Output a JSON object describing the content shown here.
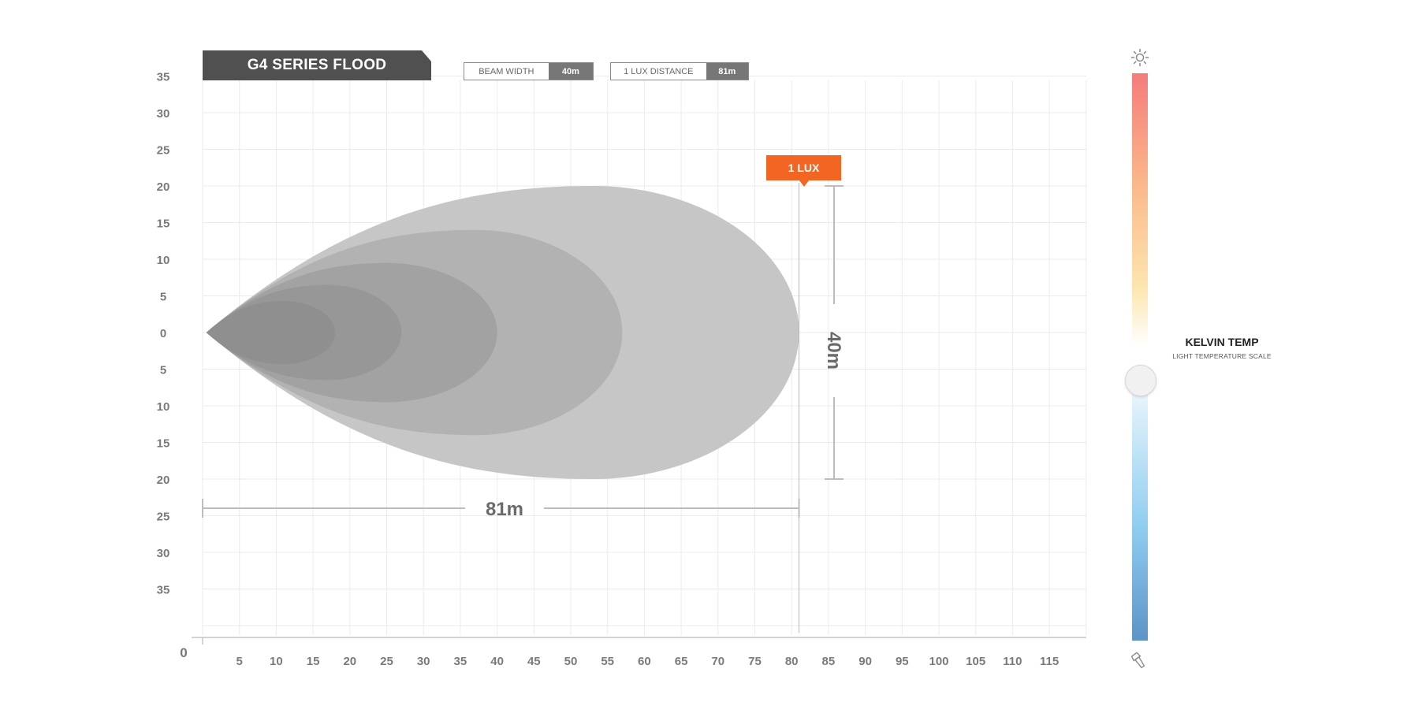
{
  "title": "G4 SERIES FLOOD",
  "stats": {
    "beam_width_label": "BEAM WIDTH",
    "beam_width_value": "40m",
    "lux_distance_label": "1 LUX DISTANCE",
    "lux_distance_value": "81m"
  },
  "lux_tag": "1 LUX",
  "kelvin": {
    "title": "KELVIN TEMP",
    "subtitle": "LIGHT TEMPERATURE SCALE",
    "position": 0.5
  },
  "colors": {
    "lux": "#f26522",
    "title_bg": "#505050",
    "grid": "#ebebeb"
  },
  "icons": {
    "top": "sun-icon",
    "bottom": "flashlight-icon"
  },
  "chart_data": {
    "type": "area",
    "x_ticks": [
      "5",
      "10",
      "15",
      "20",
      "25",
      "30",
      "35",
      "40",
      "45",
      "50",
      "55",
      "60",
      "65",
      "70",
      "75",
      "80",
      "85",
      "90",
      "95",
      "100",
      "105",
      "110",
      "115"
    ],
    "y_ticks": [
      "35",
      "30",
      "25",
      "20",
      "15",
      "10",
      "5",
      "0",
      "5",
      "10",
      "15",
      "20",
      "25",
      "30",
      "35"
    ],
    "origin_label": "0",
    "xlim": [
      0,
      120
    ],
    "ylim": [
      -40,
      35
    ],
    "grid": true,
    "series": [
      {
        "reach": 81,
        "half_width": 20,
        "peak_x": 53,
        "color": "#c6c6c6"
      },
      {
        "reach": 57,
        "half_width": 14,
        "peak_x": 37,
        "color": "#b2b2b2"
      },
      {
        "reach": 40,
        "half_width": 9.5,
        "peak_x": 25,
        "color": "#a2a2a2"
      },
      {
        "reach": 27,
        "half_width": 6.5,
        "peak_x": 17,
        "color": "#979797"
      },
      {
        "reach": 18,
        "half_width": 4.3,
        "peak_x": 11,
        "color": "#8f8f8f"
      }
    ],
    "lux_distance": 81,
    "distance_label": "81m",
    "width_label": "40m",
    "width_range": [
      -20,
      20
    ]
  }
}
